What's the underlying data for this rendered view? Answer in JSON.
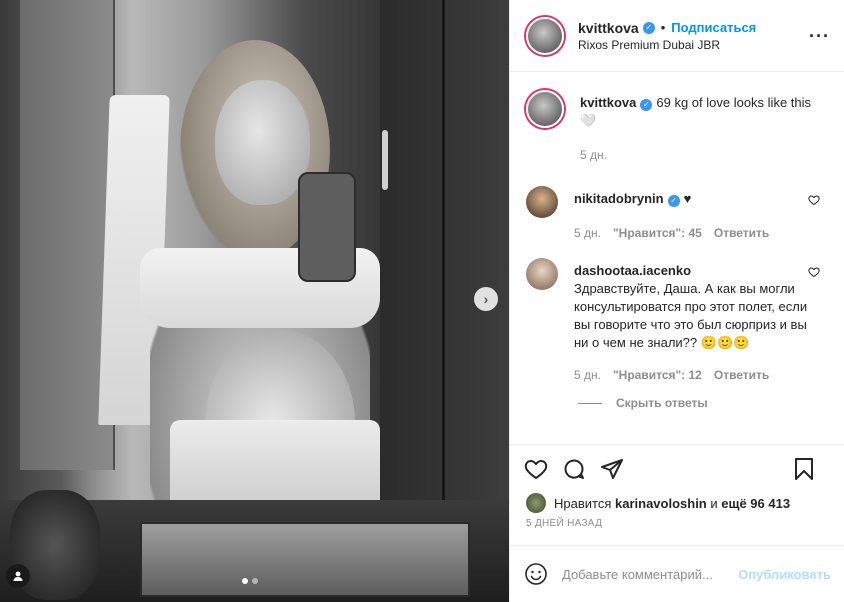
{
  "post": {
    "username": "kvittkova",
    "follow_label": "Подписаться",
    "location": "Rixos Premium Dubai JBR",
    "caption": "69 kg of love looks like this 🤍",
    "caption_time": "5 дн.",
    "likes_prefix": "Нравится",
    "likes_user": "karinavoloshin",
    "likes_mid": "и",
    "likes_rest": "ещё 96 413",
    "date": "5 ДНЕЙ НАЗАД"
  },
  "comments": [
    {
      "username": "nikitadobrynin",
      "verified": true,
      "text": "♥",
      "time": "5 дн.",
      "likes": "\"Нравится\": 45",
      "reply": "Ответить"
    },
    {
      "username": "dashootaa.iacenko",
      "verified": false,
      "text": "Здравствуйте, Даша. А как вы могли консультироватся про этот полет, если вы говорите что это был сюрприз и вы ни о чем не знали?? 🙂🙂🙂",
      "time": "5 дн.",
      "likes": "\"Нравится\": 12",
      "reply": "Ответить"
    }
  ],
  "hide_replies": "Скрыть ответы",
  "add_comment": {
    "placeholder": "Добавьте комментарий...",
    "publish": "Опубликовать"
  },
  "icons": {
    "verified": "verified-badge-icon",
    "heart": "heart-icon",
    "comment": "comment-icon",
    "share": "share-icon",
    "save": "bookmark-icon",
    "emoji": "emoji-icon",
    "more": "more-icon",
    "next": "chevron-right-icon",
    "user_tag": "user-tag-icon"
  },
  "colors": {
    "accent": "#0095f6",
    "verified": "#3897f0",
    "muted": "#8e8e8e"
  }
}
